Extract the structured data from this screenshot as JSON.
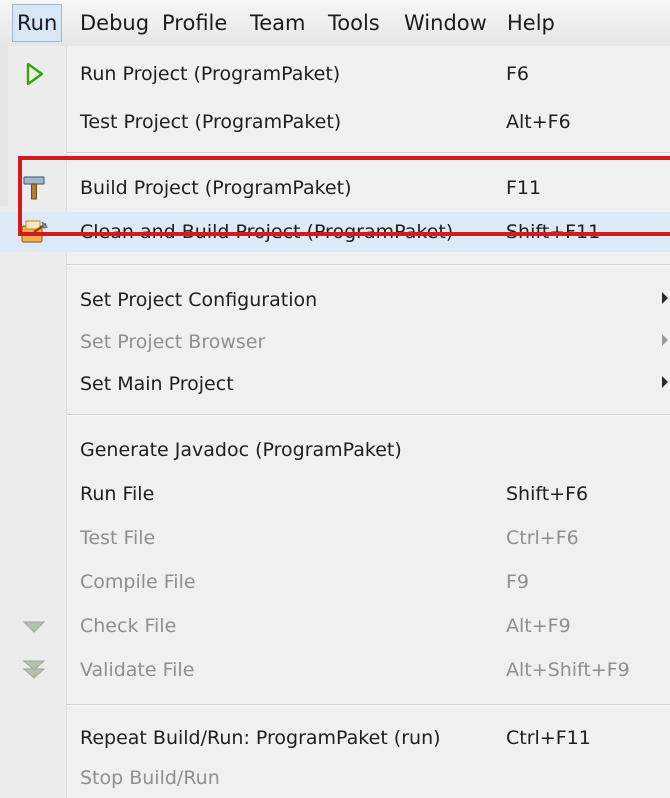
{
  "menubar": {
    "items": [
      {
        "label": "Run"
      },
      {
        "label": "Debug"
      },
      {
        "label": "Profile"
      },
      {
        "label": "Team"
      },
      {
        "label": "Tools"
      },
      {
        "label": "Window"
      },
      {
        "label": "Help"
      }
    ]
  },
  "run_menu": {
    "items": [
      {
        "label": "Run Project (ProgramPaket)",
        "shortcut": "F6",
        "icon": "run-triangle-icon"
      },
      {
        "label": "Test Project (ProgramPaket)",
        "shortcut": "Alt+F6"
      },
      {
        "label": "Build Project (ProgramPaket)",
        "shortcut": "F11",
        "icon": "hammer-icon"
      },
      {
        "label": "Clean and Build Project (ProgramPaket)",
        "shortcut": "Shift+F11",
        "icon": "clean-build-icon"
      },
      {
        "label": "Set Project Configuration",
        "submenu": true
      },
      {
        "label": "Set Project Browser",
        "submenu": true,
        "disabled": true
      },
      {
        "label": "Set Main Project",
        "submenu": true
      },
      {
        "label": "Generate Javadoc (ProgramPaket)"
      },
      {
        "label": "Run File",
        "shortcut": "Shift+F6"
      },
      {
        "label": "Test File",
        "shortcut": "Ctrl+F6",
        "disabled": true
      },
      {
        "label": "Compile File",
        "shortcut": "F9",
        "disabled": true
      },
      {
        "label": "Check File",
        "shortcut": "Alt+F9",
        "disabled": true,
        "icon": "check-file-icon"
      },
      {
        "label": "Validate File",
        "shortcut": "Alt+Shift+F9",
        "disabled": true,
        "icon": "validate-file-icon"
      },
      {
        "label": "Repeat Build/Run: ProgramPaket (run)",
        "shortcut": "Ctrl+F11"
      },
      {
        "label": "Stop Build/Run",
        "disabled": true
      }
    ]
  },
  "colors": {
    "highlight_border": "#d7191c",
    "highlight_fill": "#dce9f7",
    "disabled_text": "#8f8f8f"
  }
}
